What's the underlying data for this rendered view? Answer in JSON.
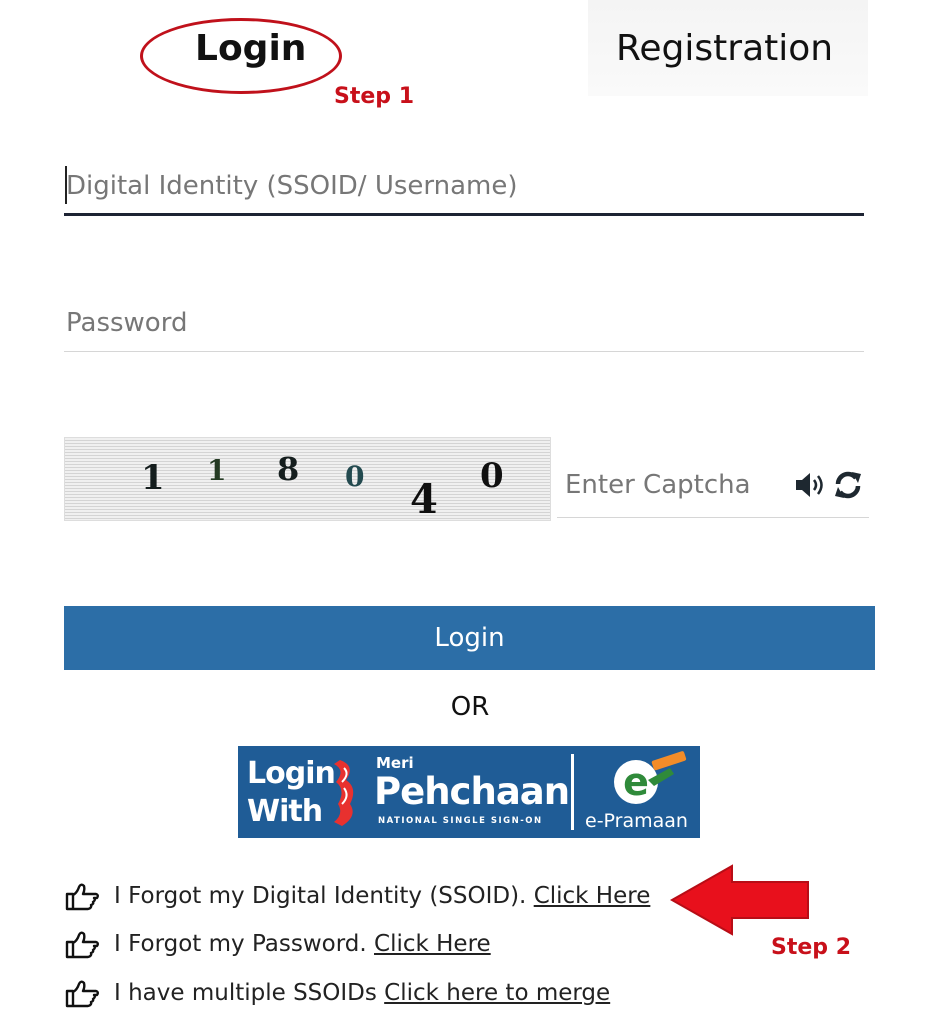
{
  "tabs": {
    "login": "Login",
    "registration": "Registration"
  },
  "annotations": {
    "step1": "Step 1",
    "step2": "Step 2",
    "color": "#c8101a"
  },
  "form": {
    "ssoid_placeholder": "Digital Identity (SSOID/ Username)",
    "password_placeholder": "Password",
    "captcha_placeholder": "Enter Captcha",
    "captcha_digits": [
      "1",
      "1",
      "8",
      "0",
      "4",
      "0"
    ],
    "login_button": "Login",
    "or_label": "OR"
  },
  "pehchaan_button": {
    "line1": "Login",
    "line2": "With",
    "meri": "Meri",
    "brand": "Pehchaan",
    "tagline": "NATIONAL SINGLE SIGN-ON",
    "epramaan": "e-Pramaan"
  },
  "help_links": [
    {
      "text": "I Forgot my Digital Identity (SSOID).",
      "link": "Click Here"
    },
    {
      "text": "I Forgot my Password.",
      "link": "Click Here"
    },
    {
      "text": "I have multiple SSOIDs",
      "link": "Click here to merge"
    }
  ],
  "icons": {
    "audio": "speaker-icon",
    "refresh": "refresh-icon",
    "hand": "hand-pointing-right-icon"
  },
  "colors": {
    "primary_button": "#2c6ea7",
    "pehchaan_bg": "#1f5c96",
    "annotation_red": "#c8101a"
  }
}
